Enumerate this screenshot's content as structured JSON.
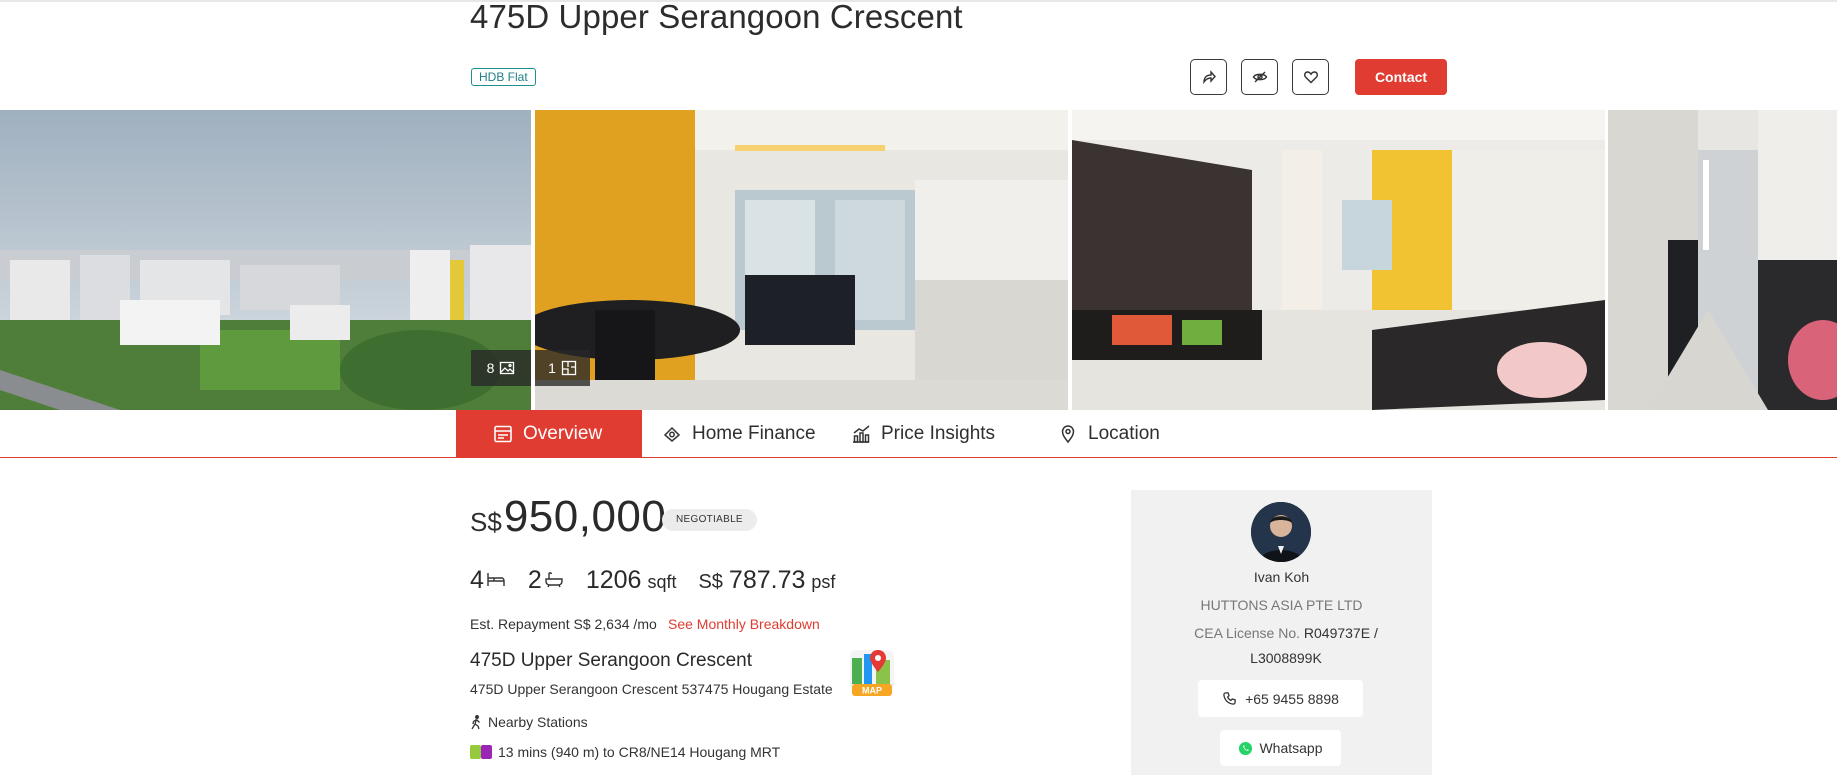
{
  "listing": {
    "title": "475D Upper Serangoon Crescent",
    "property_type": "HDB Flat"
  },
  "actions": {
    "share_icon": "share-icon",
    "hide_icon": "eye-slash-icon",
    "favorite_icon": "heart-icon",
    "contact_label": "Contact"
  },
  "gallery": {
    "photo_count": "8",
    "floorplan_count": "1"
  },
  "tabs": [
    {
      "label": "Overview",
      "icon": "overview-icon"
    },
    {
      "label": "Home Finance",
      "icon": "finance-icon"
    },
    {
      "label": "Price Insights",
      "icon": "chart-icon"
    },
    {
      "label": "Location",
      "icon": "location-pin-icon"
    }
  ],
  "price": {
    "currency": "S$",
    "amount": "950,000",
    "negotiable": "NEGOTIABLE"
  },
  "specs": {
    "bedrooms": "4",
    "bathrooms": "2",
    "area": "1206",
    "area_unit": "sqft",
    "psf_currency": "S$",
    "psf": "787.73",
    "psf_unit": "psf"
  },
  "finance": {
    "repayment": "Est. Repayment S$ 2,634 /mo",
    "breakdown_link": "See Monthly Breakdown"
  },
  "address": {
    "title": "475D Upper Serangoon Crescent",
    "full": "475D Upper Serangoon Crescent 537475 Hougang Estate",
    "map_label": "MAP"
  },
  "nearby": {
    "heading": "Nearby Stations",
    "station": "13 mins (940 m) to CR8/NE14 Hougang MRT",
    "line_colors": [
      "#97c93d",
      "#9b26b6"
    ]
  },
  "agent": {
    "name": "Ivan Koh",
    "agency": "HUTTONS ASIA PTE LTD",
    "license_label": "CEA License No.",
    "license_no": "R049737E / L3008899K",
    "phone": "+65 9455 8898",
    "whatsapp": "Whatsapp"
  },
  "colors": {
    "accent": "#e03c31",
    "teal": "#1f8f8f"
  }
}
